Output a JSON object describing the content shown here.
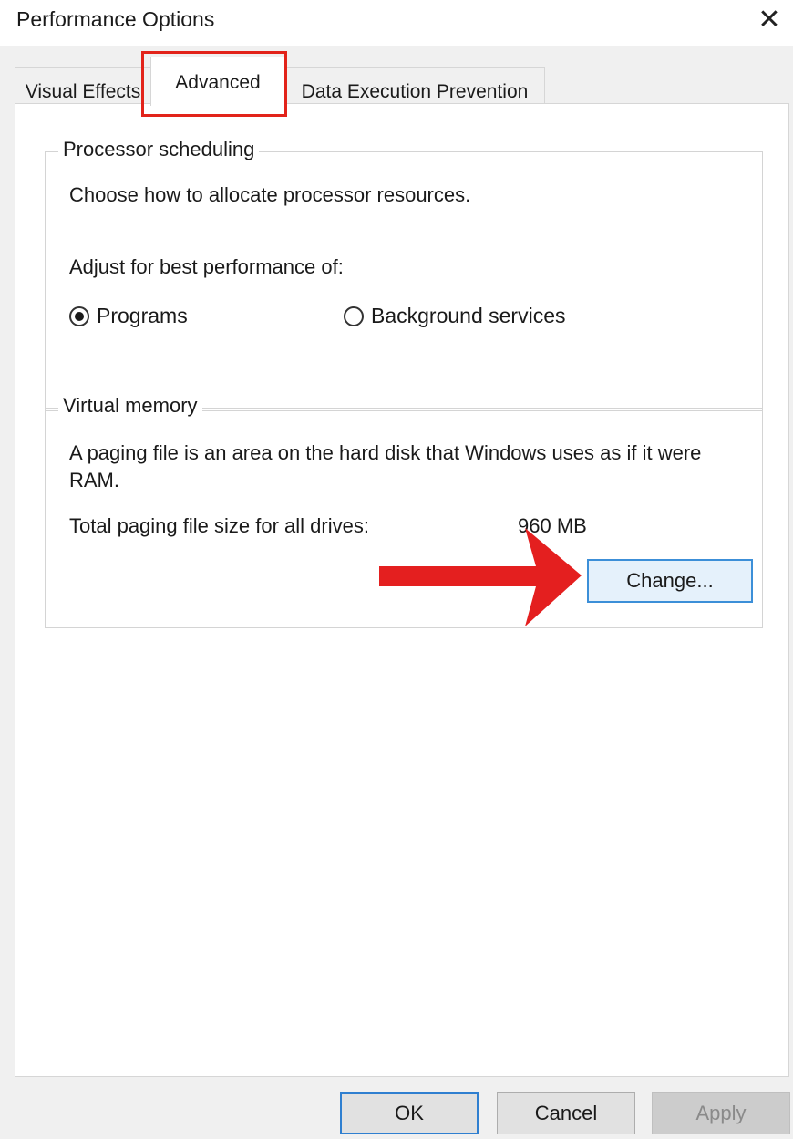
{
  "window": {
    "title": "Performance Options",
    "close_glyph": "✕"
  },
  "tabs": [
    {
      "label": "Visual Effects",
      "selected": false
    },
    {
      "label": "Advanced",
      "selected": true
    },
    {
      "label": "Data Execution Prevention",
      "selected": false
    }
  ],
  "processor_scheduling": {
    "legend": "Processor scheduling",
    "description": "Choose how to allocate processor resources.",
    "adjust_label": "Adjust for best performance of:",
    "options": [
      {
        "label": "Programs",
        "checked": true
      },
      {
        "label": "Background services",
        "checked": false
      }
    ]
  },
  "virtual_memory": {
    "legend": "Virtual memory",
    "description": "A paging file is an area on the hard disk that Windows uses as if it were RAM.",
    "total_label": "Total paging file size for all drives:",
    "total_value": "960 MB",
    "change_label": "Change..."
  },
  "footer": {
    "ok_label": "OK",
    "cancel_label": "Cancel",
    "apply_label": "Apply",
    "apply_enabled": false
  },
  "annotation_colors": {
    "highlight": "#e2231a",
    "arrow": "#e41f1f"
  }
}
